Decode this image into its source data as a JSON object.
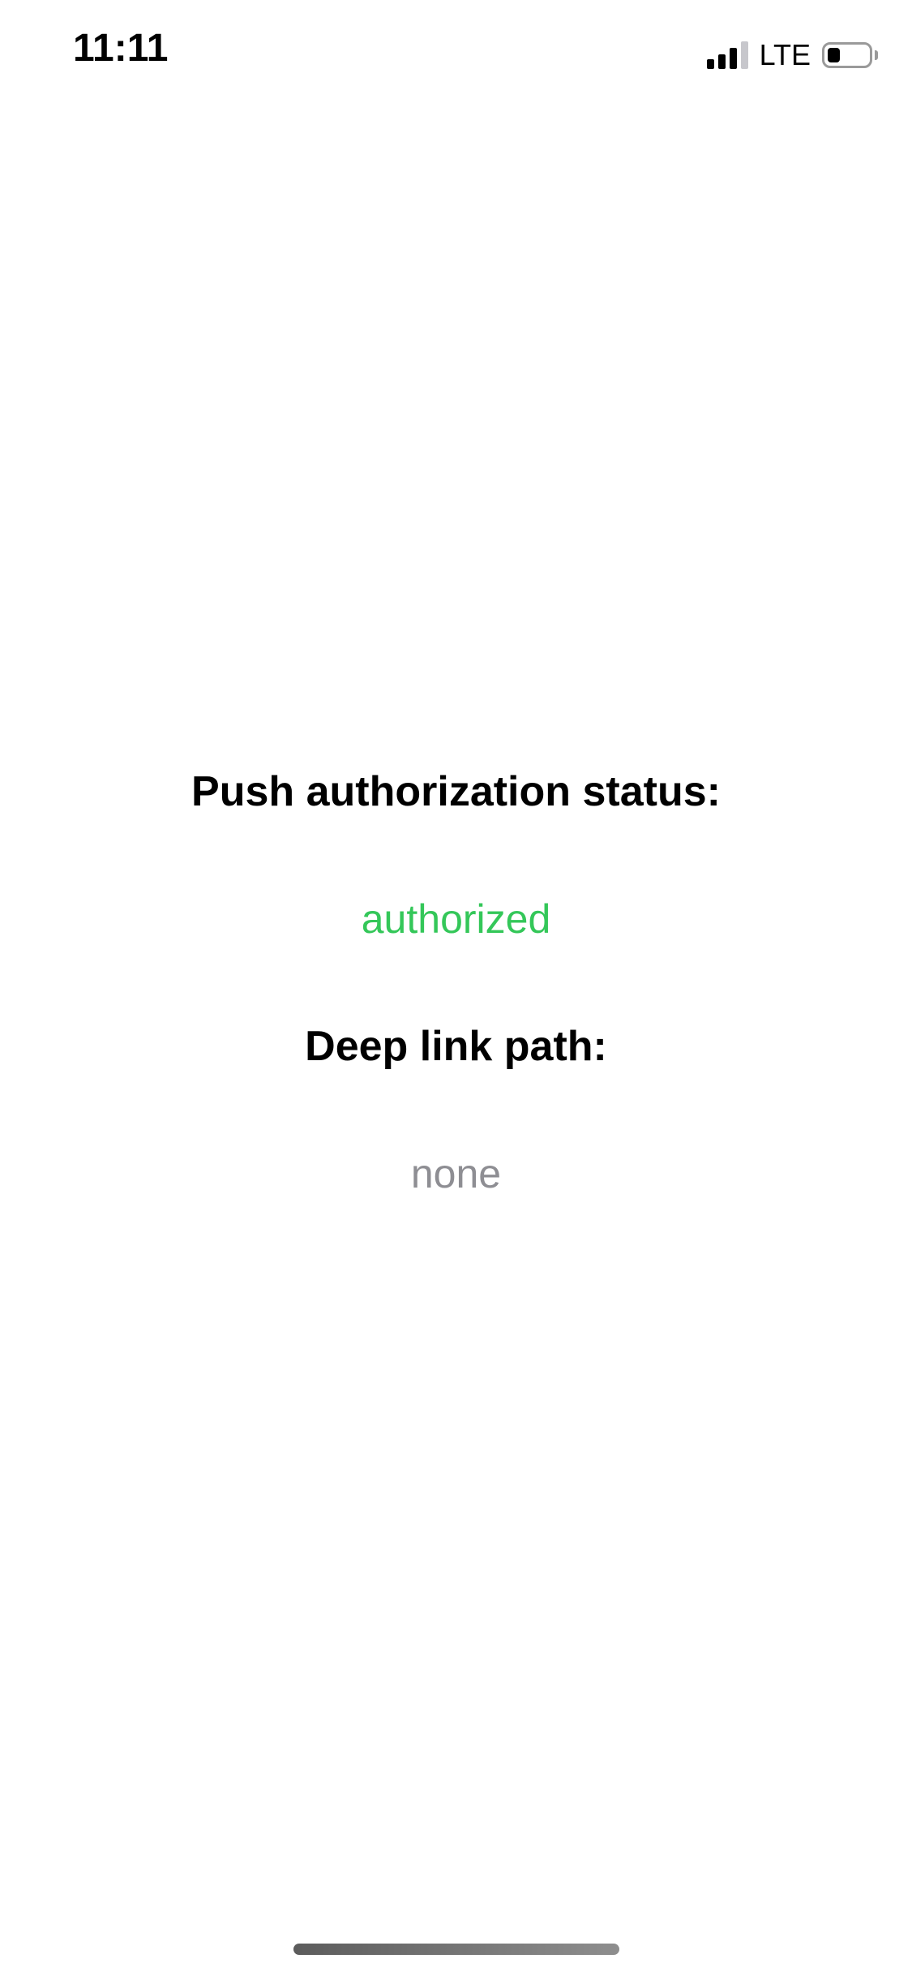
{
  "status_bar": {
    "time": "11:11",
    "network": "LTE",
    "signal_bars_active": 3,
    "signal_bars_total": 4,
    "battery_level": 0.3
  },
  "main": {
    "push_label": "Push authorization status:",
    "push_value": "authorized",
    "deep_link_label": "Deep link path:",
    "deep_link_value": "none"
  },
  "colors": {
    "authorized": "#34c759",
    "none": "#8e8e93"
  },
  "icons": {
    "signal": "cellular-signal-icon",
    "battery": "battery-icon"
  }
}
